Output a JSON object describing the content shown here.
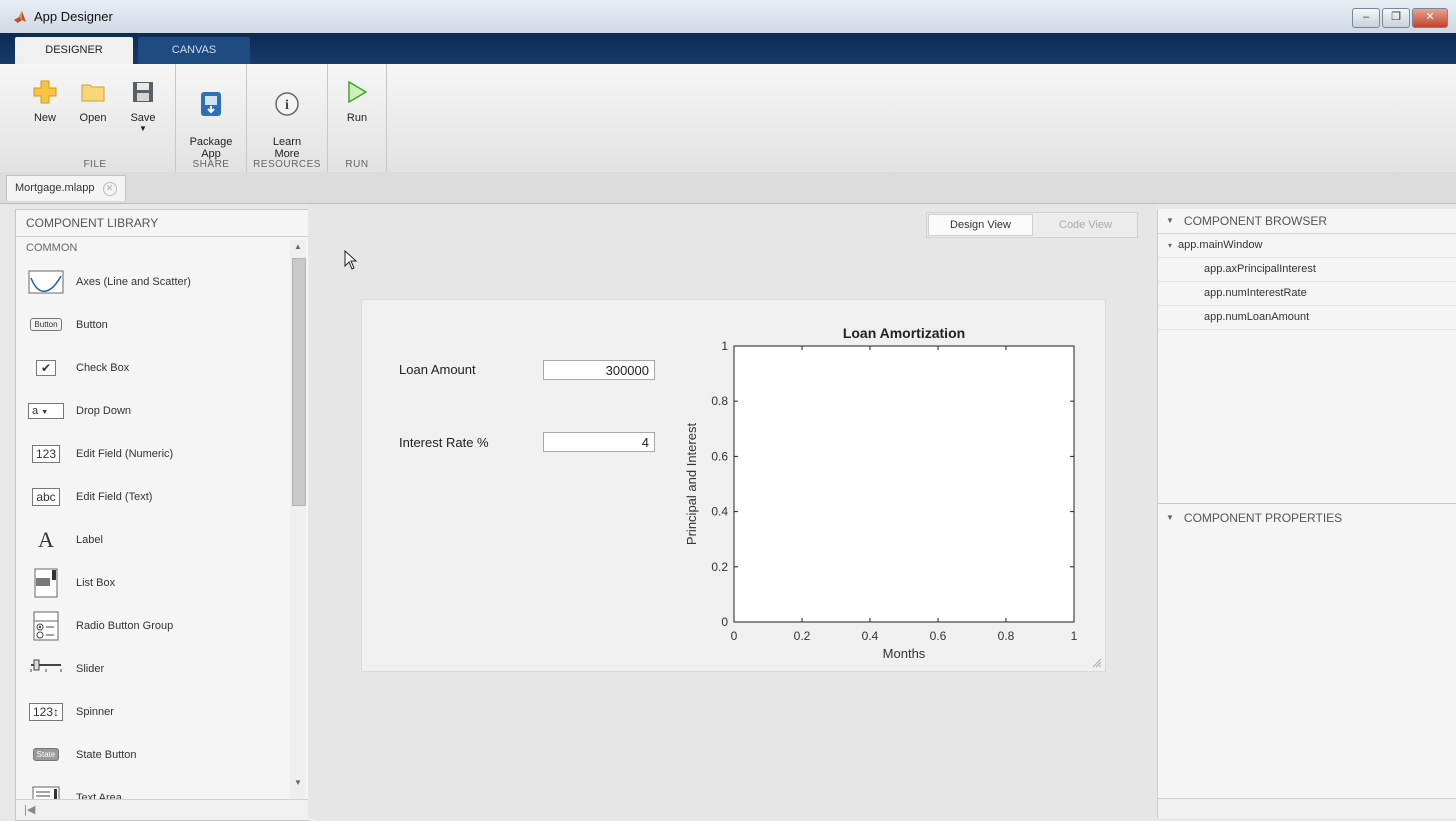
{
  "window": {
    "title": "App Designer"
  },
  "ribbon_tabs": [
    {
      "label": "DESIGNER"
    },
    {
      "label": "CANVAS"
    }
  ],
  "toolstrip": {
    "groups": [
      {
        "label": "FILE",
        "tools": [
          {
            "label": "New"
          },
          {
            "label": "Open"
          },
          {
            "label": "Save"
          }
        ]
      },
      {
        "label": "SHARE",
        "tools": [
          {
            "label": "Package\nApp"
          }
        ]
      },
      {
        "label": "RESOURCES",
        "tools": [
          {
            "label": "Learn\nMore"
          }
        ]
      },
      {
        "label": "RUN",
        "tools": [
          {
            "label": "Run"
          }
        ]
      }
    ]
  },
  "document_tab": {
    "label": "Mortgage.mlapp"
  },
  "component_library": {
    "title": "COMPONENT LIBRARY",
    "section": "COMMON",
    "items": [
      {
        "label": "Axes (Line and Scatter)",
        "icon": "axes-icon"
      },
      {
        "label": "Button",
        "icon": "button-icon"
      },
      {
        "label": "Check Box",
        "icon": "checkbox-icon"
      },
      {
        "label": "Drop Down",
        "icon": "dropdown-icon"
      },
      {
        "label": "Edit Field (Numeric)",
        "icon": "numeric-field-icon"
      },
      {
        "label": "Edit Field (Text)",
        "icon": "text-field-icon"
      },
      {
        "label": "Label",
        "icon": "label-icon"
      },
      {
        "label": "List Box",
        "icon": "listbox-icon"
      },
      {
        "label": "Radio Button Group",
        "icon": "radio-group-icon"
      },
      {
        "label": "Slider",
        "icon": "slider-icon"
      },
      {
        "label": "Spinner",
        "icon": "spinner-icon"
      },
      {
        "label": "State Button",
        "icon": "state-button-icon"
      },
      {
        "label": "Text Area",
        "icon": "textarea-icon"
      }
    ],
    "icon_text": {
      "button": "Button",
      "dropdown": "a",
      "numeric": "123",
      "text": "abc",
      "label": "A",
      "spinner": "123",
      "state": "State"
    }
  },
  "view_toggle": {
    "design": "Design View",
    "code": "Code View"
  },
  "app": {
    "loan_amount": {
      "label": "Loan Amount",
      "value": "300000"
    },
    "interest_rate": {
      "label": "Interest Rate %",
      "value": "4"
    }
  },
  "chart_data": {
    "type": "line",
    "title": "Loan Amortization",
    "xlabel": "Months",
    "ylabel": "Principal and Interest",
    "xlim": [
      0,
      1
    ],
    "ylim": [
      0,
      1
    ],
    "xticks": [
      "0",
      "0.2",
      "0.4",
      "0.6",
      "0.8",
      "1"
    ],
    "yticks": [
      "0",
      "0.2",
      "0.4",
      "0.6",
      "0.8",
      "1"
    ],
    "series": []
  },
  "component_browser": {
    "title": "COMPONENT BROWSER",
    "root": "app.mainWindow",
    "children": [
      {
        "label": "app.axPrincipalInterest"
      },
      {
        "label": "app.numInterestRate"
      },
      {
        "label": "app.numLoanAmount"
      }
    ]
  },
  "component_properties": {
    "title": "COMPONENT PROPERTIES"
  },
  "colors": {
    "ribbon_dark": "#0e2a52",
    "run_green": "#5cc34a",
    "title_bar": "#cfd8e4"
  }
}
